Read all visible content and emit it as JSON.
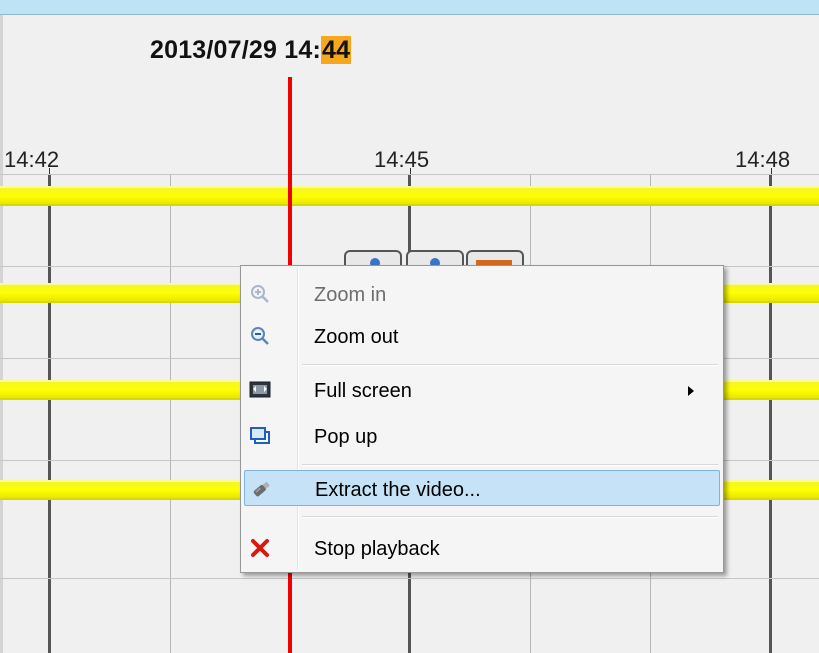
{
  "timeline": {
    "timestamp_prefix": "2013/07/29 14:",
    "timestamp_highlight": "44",
    "tick_labels": [
      "14:42",
      "14:45",
      "14:48"
    ]
  },
  "context_menu": {
    "zoom_in": "Zoom in",
    "zoom_out": "Zoom out",
    "full_screen": "Full screen",
    "pop_up": "Pop up",
    "extract_video": "Extract the video...",
    "stop_playback": "Stop playback"
  },
  "colors": {
    "cursor": "#f00000",
    "track": "#ffff00",
    "highlight": "#f6a71c",
    "menu_hover": "#c5e2f7"
  }
}
